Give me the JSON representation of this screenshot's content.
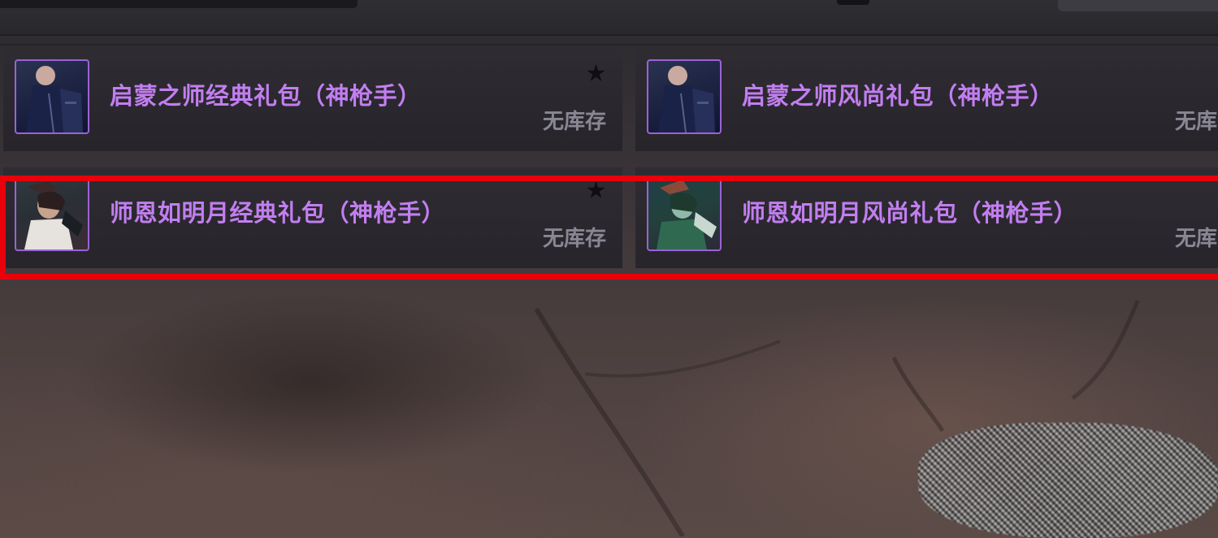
{
  "packs": [
    {
      "title": "启蒙之师经典礼包（神枪手）",
      "stock_status": "无库存",
      "favorite_icon": "star-icon"
    },
    {
      "title": "启蒙之师风尚礼包（神枪手）",
      "stock_status": "无库",
      "favorite_icon": ""
    },
    {
      "title": "师恩如明月经典礼包（神枪手）",
      "stock_status": "无库存",
      "favorite_icon": "star-icon"
    },
    {
      "title": "师恩如明月风尚礼包（神枪手）",
      "stock_status": "无库",
      "favorite_icon": ""
    }
  ],
  "star_glyph": "★",
  "colors": {
    "title_purple": "#c27ef0",
    "avatar_border": "#9b62d6",
    "highlight_red": "#e8000b",
    "stock_gray": "#8a8794"
  }
}
